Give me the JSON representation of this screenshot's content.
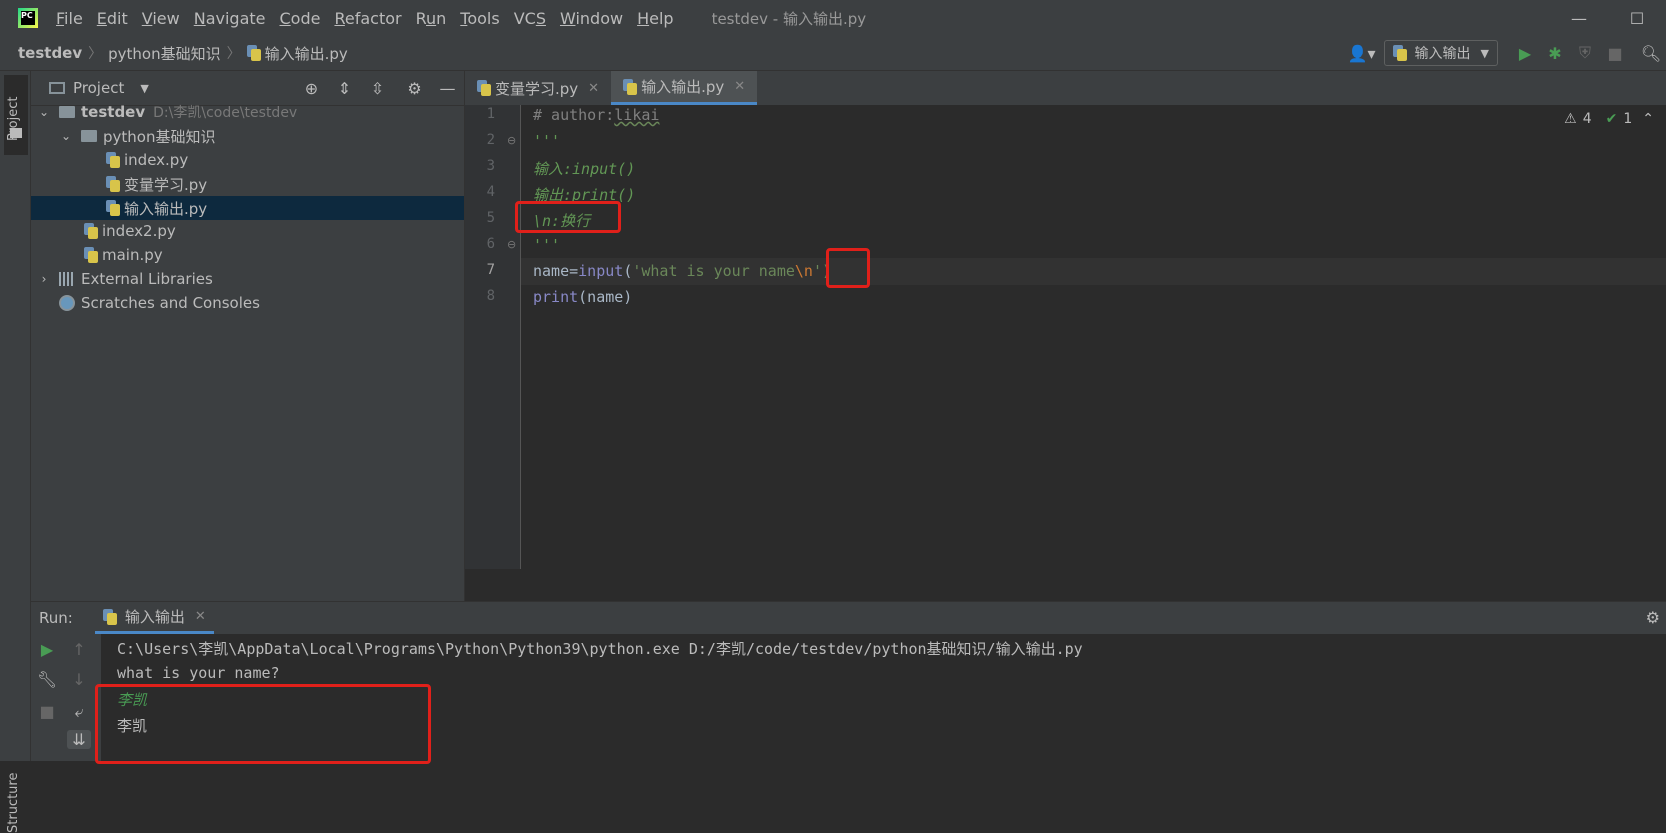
{
  "menubar": {
    "logo_text": "PC",
    "items": [
      {
        "pre": "",
        "u": "F",
        "post": "ile"
      },
      {
        "pre": "",
        "u": "E",
        "post": "dit"
      },
      {
        "pre": "",
        "u": "V",
        "post": "iew"
      },
      {
        "pre": "",
        "u": "N",
        "post": "avigate"
      },
      {
        "pre": "",
        "u": "C",
        "post": "ode"
      },
      {
        "pre": "",
        "u": "R",
        "post": "efactor"
      },
      {
        "pre": "R",
        "u": "u",
        "post": "n"
      },
      {
        "pre": "",
        "u": "T",
        "post": "ools"
      },
      {
        "pre": "VC",
        "u": "S",
        "post": ""
      },
      {
        "pre": "",
        "u": "W",
        "post": "indow"
      },
      {
        "pre": "",
        "u": "H",
        "post": "elp"
      }
    ],
    "window_title": "testdev - 输入输出.py"
  },
  "navbar": {
    "breadcrumbs": [
      "testdev",
      "python基础知识",
      "输入输出.py"
    ],
    "run_config": "输入输出"
  },
  "sidebar": {
    "project_label": "Project",
    "structure_label": "Structure"
  },
  "project_panel": {
    "title": "Project",
    "tree": {
      "root": {
        "name": "testdev",
        "path": "D:\\李凯\\code\\testdev"
      },
      "folder": "python基础知识",
      "files_in_folder": [
        "index.py",
        "变量学习.py",
        "输入输出.py"
      ],
      "root_files": [
        "index2.py",
        "main.py"
      ],
      "external_libraries": "External Libraries",
      "scratches": "Scratches and Consoles"
    },
    "selected_file": "输入输出.py"
  },
  "editor": {
    "tabs": [
      "变量学习.py",
      "输入输出.py"
    ],
    "active_tab": "输入输出.py",
    "line_numbers": [
      "1",
      "2",
      "3",
      "4",
      "5",
      "6",
      "7",
      "8"
    ],
    "code": {
      "l1_comment": "# author:",
      "l1_author": "likai",
      "l2": "'''",
      "l3": "输入:input()",
      "l4": "输出:print()",
      "l5": "\\n:换行",
      "l6": "'''",
      "l7_name": "name=",
      "l7_func": "input",
      "l7_paren": "(",
      "l7_str": "'what is your name",
      "l7_esc": "\\n",
      "l7_end": "')",
      "l8_func": "print",
      "l8_rest": "(name)"
    },
    "inspections": {
      "warnings": "4",
      "weak_warnings": "1"
    }
  },
  "run_panel": {
    "label": "Run:",
    "tab": "输入输出",
    "console": {
      "command": "C:\\Users\\李凯\\AppData\\Local\\Programs\\Python\\Python39\\python.exe D:/李凯/code/testdev/python基础知识/输入输出.py",
      "prompt": "what is your name?",
      "input": "李凯",
      "output": "李凯"
    }
  },
  "colors": {
    "accent": "#4a88c7",
    "highlight_box": "#e0201a",
    "docstring": "#629755",
    "string": "#6a8759"
  }
}
